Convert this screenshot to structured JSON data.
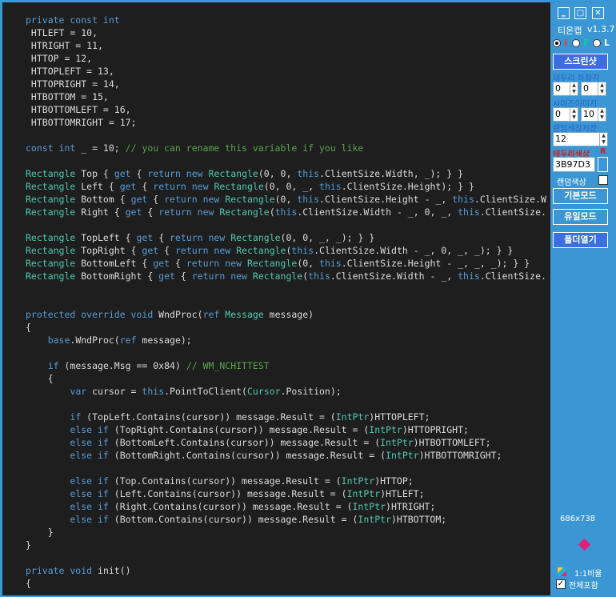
{
  "code": [
    [
      [
        "kw",
        "private const int"
      ]
    ],
    [
      [
        "tx",
        " HTLEFT = 10,"
      ]
    ],
    [
      [
        "tx",
        " HTRIGHT = 11,"
      ]
    ],
    [
      [
        "tx",
        " HTTOP = 12,"
      ]
    ],
    [
      [
        "tx",
        " HTTOPLEFT = 13,"
      ]
    ],
    [
      [
        "tx",
        " HTTOPRIGHT = 14,"
      ]
    ],
    [
      [
        "tx",
        " HTBOTTOM = 15,"
      ]
    ],
    [
      [
        "tx",
        " HTBOTTOMLEFT = 16,"
      ]
    ],
    [
      [
        "tx",
        " HTBOTTOMRIGHT = 17;"
      ]
    ],
    [],
    [
      [
        "kw",
        "const int"
      ],
      [
        "tx",
        " _ = 10; "
      ],
      [
        "cm",
        "// you can rename this variable if you like"
      ]
    ],
    [],
    [
      [
        "ty",
        "Rectangle"
      ],
      [
        "tx",
        " Top { "
      ],
      [
        "kw",
        "get"
      ],
      [
        "tx",
        " { "
      ],
      [
        "kw",
        "return new"
      ],
      [
        "tx",
        " "
      ],
      [
        "ty",
        "Rectangle"
      ],
      [
        "tx",
        "(0, 0, "
      ],
      [
        "kw",
        "this"
      ],
      [
        "tx",
        ".ClientSize.Width, _); } }"
      ]
    ],
    [
      [
        "ty",
        "Rectangle"
      ],
      [
        "tx",
        " Left { "
      ],
      [
        "kw",
        "get"
      ],
      [
        "tx",
        " { "
      ],
      [
        "kw",
        "return new"
      ],
      [
        "tx",
        " "
      ],
      [
        "ty",
        "Rectangle"
      ],
      [
        "tx",
        "(0, 0, _, "
      ],
      [
        "kw",
        "this"
      ],
      [
        "tx",
        ".ClientSize.Height); } }"
      ]
    ],
    [
      [
        "ty",
        "Rectangle"
      ],
      [
        "tx",
        " Bottom { "
      ],
      [
        "kw",
        "get"
      ],
      [
        "tx",
        " { "
      ],
      [
        "kw",
        "return new"
      ],
      [
        "tx",
        " "
      ],
      [
        "ty",
        "Rectangle"
      ],
      [
        "tx",
        "(0, "
      ],
      [
        "kw",
        "this"
      ],
      [
        "tx",
        ".ClientSize.Height - _, "
      ],
      [
        "kw",
        "this"
      ],
      [
        "tx",
        ".ClientSize.W"
      ]
    ],
    [
      [
        "ty",
        "Rectangle"
      ],
      [
        "tx",
        " Right { "
      ],
      [
        "kw",
        "get"
      ],
      [
        "tx",
        " { "
      ],
      [
        "kw",
        "return new"
      ],
      [
        "tx",
        " "
      ],
      [
        "ty",
        "Rectangle"
      ],
      [
        "tx",
        "("
      ],
      [
        "kw",
        "this"
      ],
      [
        "tx",
        ".ClientSize.Width - _, 0, _, "
      ],
      [
        "kw",
        "this"
      ],
      [
        "tx",
        ".ClientSize."
      ]
    ],
    [],
    [
      [
        "ty",
        "Rectangle"
      ],
      [
        "tx",
        " TopLeft { "
      ],
      [
        "kw",
        "get"
      ],
      [
        "tx",
        " { "
      ],
      [
        "kw",
        "return new"
      ],
      [
        "tx",
        " "
      ],
      [
        "ty",
        "Rectangle"
      ],
      [
        "tx",
        "(0, 0, _, _); } }"
      ]
    ],
    [
      [
        "ty",
        "Rectangle"
      ],
      [
        "tx",
        " TopRight { "
      ],
      [
        "kw",
        "get"
      ],
      [
        "tx",
        " { "
      ],
      [
        "kw",
        "return new"
      ],
      [
        "tx",
        " "
      ],
      [
        "ty",
        "Rectangle"
      ],
      [
        "tx",
        "("
      ],
      [
        "kw",
        "this"
      ],
      [
        "tx",
        ".ClientSize.Width - _, 0, _, _); } }"
      ]
    ],
    [
      [
        "ty",
        "Rectangle"
      ],
      [
        "tx",
        " BottomLeft { "
      ],
      [
        "kw",
        "get"
      ],
      [
        "tx",
        " { "
      ],
      [
        "kw",
        "return new"
      ],
      [
        "tx",
        " "
      ],
      [
        "ty",
        "Rectangle"
      ],
      [
        "tx",
        "(0, "
      ],
      [
        "kw",
        "this"
      ],
      [
        "tx",
        ".ClientSize.Height - _, _, _); } }"
      ]
    ],
    [
      [
        "ty",
        "Rectangle"
      ],
      [
        "tx",
        " BottomRight { "
      ],
      [
        "kw",
        "get"
      ],
      [
        "tx",
        " { "
      ],
      [
        "kw",
        "return new"
      ],
      [
        "tx",
        " "
      ],
      [
        "ty",
        "Rectangle"
      ],
      [
        "tx",
        "("
      ],
      [
        "kw",
        "this"
      ],
      [
        "tx",
        ".ClientSize.Width - _, "
      ],
      [
        "kw",
        "this"
      ],
      [
        "tx",
        ".ClientSize."
      ]
    ],
    [],
    [],
    [
      [
        "kw",
        "protected override void"
      ],
      [
        "tx",
        " WndProc("
      ],
      [
        "kw",
        "ref"
      ],
      [
        "tx",
        " "
      ],
      [
        "ty",
        "Message"
      ],
      [
        "tx",
        " message)"
      ]
    ],
    [
      [
        "tx",
        "{"
      ]
    ],
    [
      [
        "tx",
        "    "
      ],
      [
        "kw",
        "base"
      ],
      [
        "tx",
        ".WndProc("
      ],
      [
        "kw",
        "ref"
      ],
      [
        "tx",
        " message);"
      ]
    ],
    [],
    [
      [
        "tx",
        "    "
      ],
      [
        "kw",
        "if"
      ],
      [
        "tx",
        " (message.Msg == 0x84) "
      ],
      [
        "cm",
        "// WM_NCHITTEST"
      ]
    ],
    [
      [
        "tx",
        "    {"
      ]
    ],
    [
      [
        "tx",
        "        "
      ],
      [
        "kw",
        "var"
      ],
      [
        "tx",
        " cursor = "
      ],
      [
        "kw",
        "this"
      ],
      [
        "tx",
        ".PointToClient("
      ],
      [
        "ty",
        "Cursor"
      ],
      [
        "tx",
        ".Position);"
      ]
    ],
    [],
    [
      [
        "tx",
        "        "
      ],
      [
        "kw",
        "if"
      ],
      [
        "tx",
        " (TopLeft.Contains(cursor)) message.Result = ("
      ],
      [
        "ty",
        "IntPtr"
      ],
      [
        "tx",
        ")HTTOPLEFT;"
      ]
    ],
    [
      [
        "tx",
        "        "
      ],
      [
        "kw",
        "else if"
      ],
      [
        "tx",
        " (TopRight.Contains(cursor)) message.Result = ("
      ],
      [
        "ty",
        "IntPtr"
      ],
      [
        "tx",
        ")HTTOPRIGHT;"
      ]
    ],
    [
      [
        "tx",
        "        "
      ],
      [
        "kw",
        "else if"
      ],
      [
        "tx",
        " (BottomLeft.Contains(cursor)) message.Result = ("
      ],
      [
        "ty",
        "IntPtr"
      ],
      [
        "tx",
        ")HTBOTTOMLEFT;"
      ]
    ],
    [
      [
        "tx",
        "        "
      ],
      [
        "kw",
        "else if"
      ],
      [
        "tx",
        " (BottomRight.Contains(cursor)) message.Result = ("
      ],
      [
        "ty",
        "IntPtr"
      ],
      [
        "tx",
        ")HTBOTTOMRIGHT;"
      ]
    ],
    [],
    [
      [
        "tx",
        "        "
      ],
      [
        "kw",
        "else if"
      ],
      [
        "tx",
        " (Top.Contains(cursor)) message.Result = ("
      ],
      [
        "ty",
        "IntPtr"
      ],
      [
        "tx",
        ")HTTOP;"
      ]
    ],
    [
      [
        "tx",
        "        "
      ],
      [
        "kw",
        "else if"
      ],
      [
        "tx",
        " (Left.Contains(cursor)) message.Result = ("
      ],
      [
        "ty",
        "IntPtr"
      ],
      [
        "tx",
        ")HTLEFT;"
      ]
    ],
    [
      [
        "tx",
        "        "
      ],
      [
        "kw",
        "else if"
      ],
      [
        "tx",
        " (Right.Contains(cursor)) message.Result = ("
      ],
      [
        "ty",
        "IntPtr"
      ],
      [
        "tx",
        ")HTRIGHT;"
      ]
    ],
    [
      [
        "tx",
        "        "
      ],
      [
        "kw",
        "else if"
      ],
      [
        "tx",
        " (Bottom.Contains(cursor)) message.Result = ("
      ],
      [
        "ty",
        "IntPtr"
      ],
      [
        "tx",
        ")HTBOTTOM;"
      ]
    ],
    [
      [
        "tx",
        "    }"
      ]
    ],
    [
      [
        "tx",
        "}"
      ]
    ],
    [],
    [
      [
        "kw",
        "private void"
      ],
      [
        "tx",
        " init()"
      ]
    ],
    [
      [
        "tx",
        "{"
      ]
    ]
  ],
  "panel": {
    "window_buttons": [
      "minimize-icon",
      "maximize-icon",
      "close-icon"
    ],
    "app_name": "티온캡",
    "version": "v1.3.7",
    "mode_radios": [
      {
        "label": "I",
        "color": "#ff3333",
        "checked": true
      },
      {
        "label": "F",
        "color": "#00d0a0",
        "checked": false
      },
      {
        "label": "L",
        "color": "#ffffff",
        "checked": false
      }
    ],
    "screenshot_button": "스크린샷",
    "border_thickness_label": "테두리 하장각",
    "border_value_1": "0",
    "border_value_2": "0",
    "size_label": "사이즈이미지",
    "size_value_1": "0",
    "size_value_2": "10",
    "random_save_label": "랜덤색장저장",
    "random_save_value": "12",
    "border_color_label": "테두리색상",
    "border_color_r": "R",
    "color_hex": "3B97D3",
    "color_swatch": "#3b97d3",
    "random_color_label": "랜덤색상",
    "basic_mode_button": "기본모드",
    "user_mode_button": "유일모드",
    "open_folder_button": "폴더열기",
    "size_readout": "686x738",
    "ratio_label": "1:1비율",
    "include_all_label": "전체포함",
    "include_all_checked": true,
    "accent_color": "#3b6ee0",
    "background_color": "#3b97d3",
    "editor_background": "#1e1e1e"
  }
}
